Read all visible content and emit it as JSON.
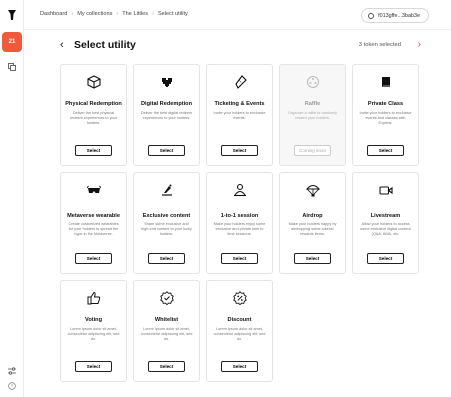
{
  "sidebar": {
    "logo_icon": "tree-logo-icon",
    "active_item": "21",
    "items": [
      "copy-icon",
      "sliders-icon",
      "help-icon"
    ]
  },
  "breadcrumb": [
    "Dashboard",
    "My collections",
    "The Littles",
    "Select utility"
  ],
  "wallet": {
    "address": "f013gffe...3bab3e",
    "icon": "wallet-icon"
  },
  "header": {
    "back_label": "‹",
    "title": "Select utility",
    "selected_text": "3 token selected",
    "next_label": "›"
  },
  "colors": {
    "accent": "#f05a3c",
    "border": "#e4e4e4"
  },
  "cards": [
    {
      "title": "Physical Redemption",
      "icon": "box-icon",
      "desc": "Deliver the best physical redeem experiences to your holders.",
      "button": "Select",
      "disabled": false
    },
    {
      "title": "Digital Redemption",
      "icon": "pixel-heart-icon",
      "desc": "Deliver the best digital redeem experiences to your holders.",
      "button": "Select",
      "disabled": false
    },
    {
      "title": "Ticketing & Events",
      "icon": "ticket-icon",
      "desc": "Invite your holders to exclusive events.",
      "button": "Select",
      "disabled": false
    },
    {
      "title": "Raffle",
      "icon": "raffle-icon",
      "desc": "Organize a raffle to randomly reward your holders.",
      "button": "Coming soon",
      "disabled": true
    },
    {
      "title": "Private Class",
      "icon": "book-icon",
      "desc": "Invite your holders to exclusive events and classes with Experts.",
      "button": "Select",
      "disabled": false
    },
    {
      "title": "Metaverse wearable",
      "icon": "vr-glasses-icon",
      "desc": "Create customized wearables for your holders to spread the hype in the Metaverse.",
      "button": "Select",
      "disabled": false
    },
    {
      "title": "Exclusive content",
      "icon": "content-icon",
      "desc": "Share some exclusive and high-end content to your lucky holders.",
      "button": "Select",
      "disabled": false
    },
    {
      "title": "1-to-1 session",
      "icon": "session-icon",
      "desc": "Make your holders enjoy some exclusive and private time to time sessions.",
      "button": "Select",
      "disabled": false
    },
    {
      "title": "Airdrop",
      "icon": "parachute-icon",
      "desc": "Make your holders happy by airdropping some tokens/ rewards items.",
      "button": "Select",
      "disabled": false
    },
    {
      "title": "Livestream",
      "icon": "video-icon",
      "desc": "Allow your holders to access some exclusive digital content (Q&A, AMA, etc.",
      "button": "Select",
      "disabled": false
    },
    {
      "title": "Voting",
      "icon": "thumbs-up-icon",
      "desc": "Lorem ipsum dolor sit amet, consectetur adipiscing elit, sed do.",
      "button": "Select",
      "disabled": false
    },
    {
      "title": "Whitelist",
      "icon": "check-badge-icon",
      "desc": "Lorem ipsum dolor sit amet, consectetur adipiscing elit, sed do.",
      "button": "Select",
      "disabled": false
    },
    {
      "title": "Discount",
      "icon": "discount-badge-icon",
      "desc": "Lorem ipsum dolor sit amet, consectetur adipiscing elit, sed do.",
      "button": "Select",
      "disabled": false
    }
  ]
}
